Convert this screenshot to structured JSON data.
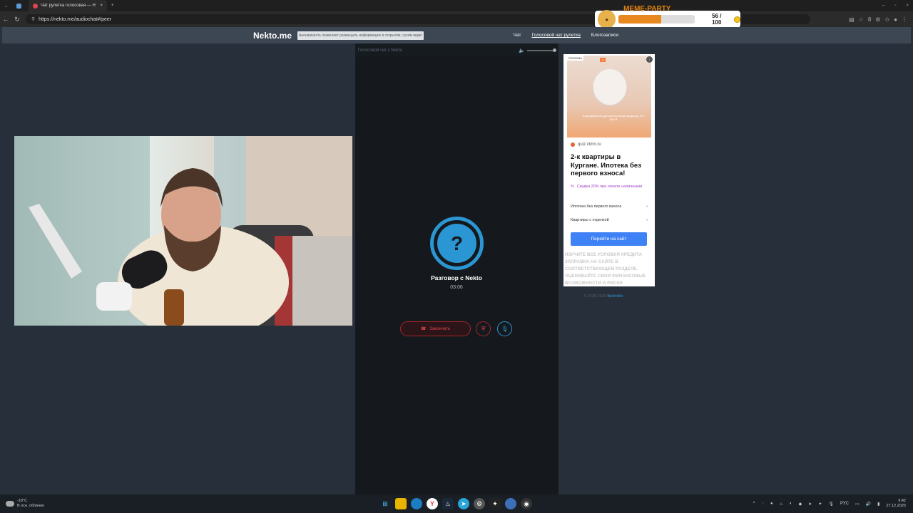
{
  "browser": {
    "tab_title": "Чат рулетка голосовая — Н",
    "url": "https://nekto.me/audiochat#/peer",
    "zoom_badge": "8"
  },
  "meme_party": {
    "title": "MEME-PARTY",
    "count": "56 / 100",
    "progress": 0.56
  },
  "site": {
    "logo": "Nekto.me",
    "notice": "Анонимность позволяет размещать информацию в открытом, сухом виде!",
    "nav": [
      "Чат",
      "Голосовой чат рулетка",
      "Блогозаписи"
    ]
  },
  "chat": {
    "header": "Голосовой чат с Nekto",
    "avatar_symbol": "?",
    "title": "Разговор с Nekto",
    "timer": "03:06",
    "end_button": "Закончить"
  },
  "ad": {
    "tag": "РЕКЛАМА",
    "menu": "⋮",
    "image_caption": "Благодарность дополнительная скидка до 270 000 ₽",
    "domain": "quiz.vtmn.ru",
    "title": "2-к квартиры в Кургане. Ипотека без первого взноса!",
    "promo": "Скидка 20% при оплате наличными",
    "links": [
      "Ипотека без первого взноса",
      "Квартиры с отделкой"
    ],
    "cta": "Перейти на сайт",
    "disclaimer": "ИЗУЧИТЕ ВСЕ УСЛОВИЯ КРЕДИТА ЗАПРАВКА НА САЙТЕ В СООТВЕТСТВУЮЩЕМ РАЗДЕЛЕ. ОЦЕНИВАЙТЕ СВОИ ФИНАНСОВЫЕ ВОЗМОЖНОСТИ И РИСКИ"
  },
  "copyright": {
    "text": "© 2025-2026",
    "link": "NektoMe"
  },
  "taskbar": {
    "temp": "-18°C",
    "weather": "В осн. облачно",
    "lang": "РУС",
    "time": "9:42",
    "date": "27.12.2025"
  }
}
